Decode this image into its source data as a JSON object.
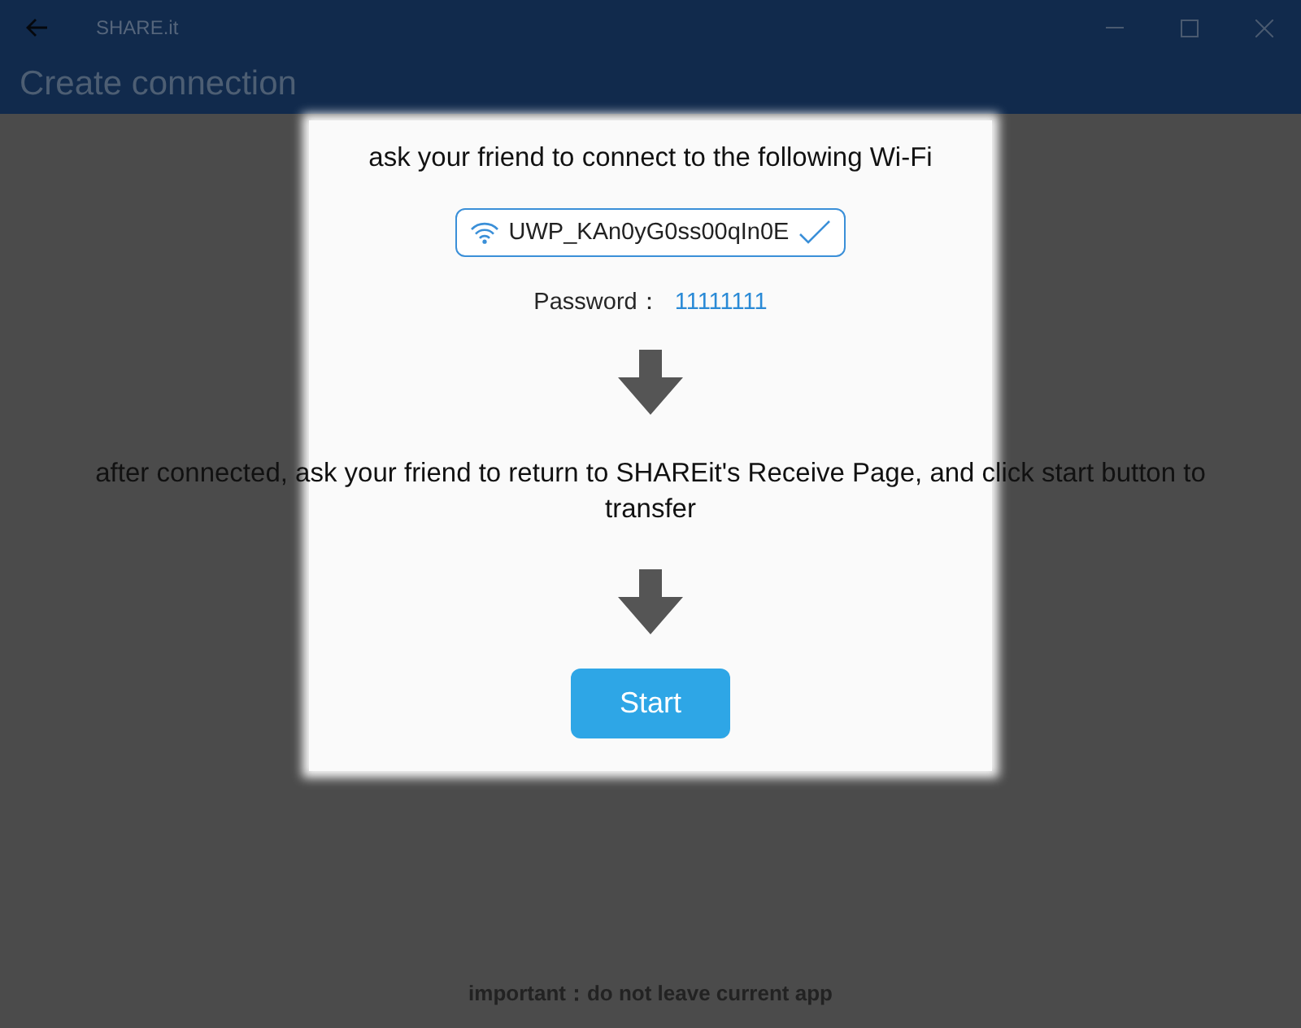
{
  "title_bar": {
    "title": "SHARE.it"
  },
  "header": {
    "title": "Create connection"
  },
  "steps": [
    {
      "kind": "text",
      "text": "ask your friend to connect to the following Wi-Fi"
    },
    {
      "kind": "network",
      "ssid": "UWP_KAn0yG0ss00qIn0E"
    },
    {
      "kind": "password",
      "label": "Password：",
      "value": "11111111"
    },
    {
      "kind": "arrow"
    },
    {
      "kind": "text",
      "text": "after connected, ask your friend to return to SHAREit's Receive Page, and click start button to transfer"
    },
    {
      "kind": "arrow"
    },
    {
      "kind": "button",
      "label": "Start"
    }
  ],
  "footer_note": "important：do not leave current app"
}
